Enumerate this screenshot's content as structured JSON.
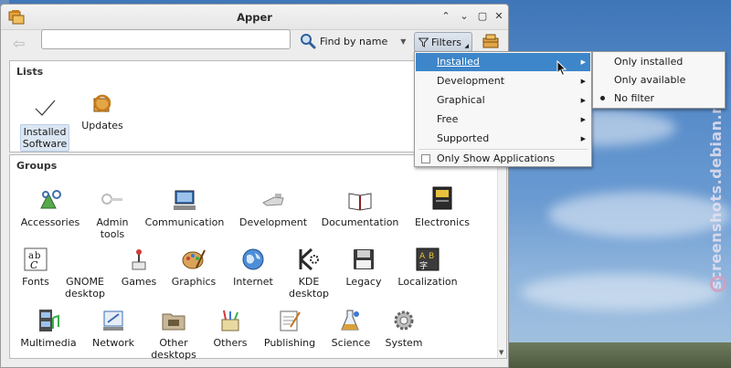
{
  "window": {
    "title": "Apper"
  },
  "toolbar": {
    "search_value": "",
    "find_label": "Find by name",
    "filters_label": "Filters"
  },
  "lists": {
    "heading": "Lists",
    "items": [
      {
        "label_line1": "Installed",
        "label_line2": "Software",
        "icon": "checkmark-icon",
        "selected": true
      },
      {
        "label_line1": "Updates",
        "label_line2": "",
        "icon": "updates-icon",
        "selected": false
      }
    ]
  },
  "groups": {
    "heading": "Groups",
    "items": [
      {
        "l1": "Accessories",
        "l2": "",
        "icon": "accessories-icon"
      },
      {
        "l1": "Admin",
        "l2": "tools",
        "icon": "admin-tools-icon"
      },
      {
        "l1": "Communication",
        "l2": "",
        "icon": "communication-icon"
      },
      {
        "l1": "Development",
        "l2": "",
        "icon": "development-icon"
      },
      {
        "l1": "Documentation",
        "l2": "",
        "icon": "documentation-icon"
      },
      {
        "l1": "Electronics",
        "l2": "",
        "icon": "electronics-icon"
      },
      {
        "l1": "Fonts",
        "l2": "",
        "icon": "fonts-icon"
      },
      {
        "l1": "GNOME",
        "l2": "desktop",
        "icon": "gnome-desktop-icon"
      },
      {
        "l1": "Games",
        "l2": "",
        "icon": "games-icon"
      },
      {
        "l1": "Graphics",
        "l2": "",
        "icon": "graphics-icon"
      },
      {
        "l1": "Internet",
        "l2": "",
        "icon": "internet-icon"
      },
      {
        "l1": "KDE",
        "l2": "desktop",
        "icon": "kde-desktop-icon"
      },
      {
        "l1": "Legacy",
        "l2": "",
        "icon": "legacy-icon"
      },
      {
        "l1": "Localization",
        "l2": "",
        "icon": "localization-icon"
      },
      {
        "l1": "Multimedia",
        "l2": "",
        "icon": "multimedia-icon"
      },
      {
        "l1": "Network",
        "l2": "",
        "icon": "network-icon"
      },
      {
        "l1": "Other",
        "l2": "desktops",
        "icon": "other-desktops-icon"
      },
      {
        "l1": "Others",
        "l2": "",
        "icon": "others-icon"
      },
      {
        "l1": "Publishing",
        "l2": "",
        "icon": "publishing-icon"
      },
      {
        "l1": "Science",
        "l2": "",
        "icon": "science-icon"
      },
      {
        "l1": "System",
        "l2": "",
        "icon": "system-icon"
      }
    ]
  },
  "filter_menu": {
    "items": [
      {
        "label": "Installed",
        "has_submenu": true,
        "active": true
      },
      {
        "label": "Development",
        "has_submenu": true,
        "active": false
      },
      {
        "label": "Graphical",
        "has_submenu": true,
        "active": false
      },
      {
        "label": "Free",
        "has_submenu": true,
        "active": false
      },
      {
        "label": "Supported",
        "has_submenu": true,
        "active": false
      }
    ],
    "checkbox_label": "Only Show Applications",
    "checkbox_checked": false
  },
  "installed_submenu": {
    "items": [
      {
        "label": "Only installed",
        "selected": false
      },
      {
        "label": "Only available",
        "selected": false
      },
      {
        "label": "No filter",
        "selected": true
      }
    ]
  },
  "watermark": "screenshots.debian.net",
  "colors": {
    "menu_highlight": "#3d86c9",
    "selection_bg": "#dbe6f3"
  }
}
